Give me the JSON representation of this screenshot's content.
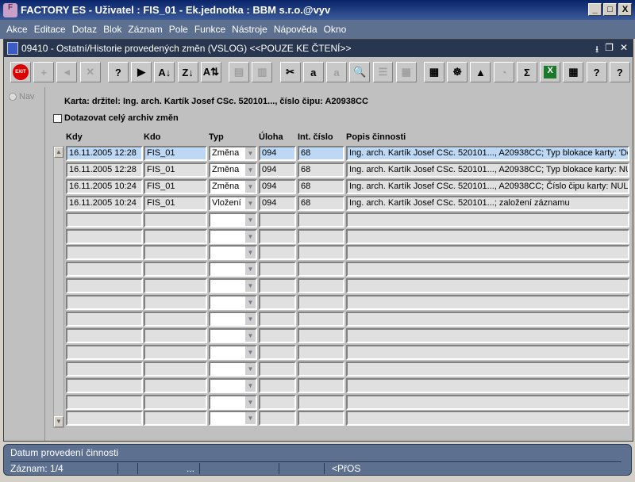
{
  "app": {
    "title": "FACTORY ES - Uživatel : FIS_01 - Ek.jednotka : BBM s.r.o.@vyv",
    "min": "_",
    "max": "□",
    "close": "X"
  },
  "menu": [
    "Akce",
    "Editace",
    "Dotaz",
    "Blok",
    "Záznam",
    "Pole",
    "Funkce",
    "Nástroje",
    "Nápověda",
    "Okno"
  ],
  "form": {
    "title": "09410 - Ostatní/Historie provedených změn (VSLOG) <<POUZE KE ČTENÍ>>"
  },
  "toolbar": [
    {
      "icon": "exit-icon",
      "g": "EXIT"
    },
    {
      "icon": "insert-record-icon",
      "g": "+",
      "dis": true
    },
    {
      "icon": "delete-record-icon",
      "g": "◂",
      "dis": true
    },
    {
      "icon": "clear-icon",
      "g": "✕",
      "dis": true
    },
    {
      "icon": "enter-query-icon",
      "g": "?",
      "gap": true
    },
    {
      "icon": "execute-query-icon",
      "g": "▶"
    },
    {
      "icon": "sort-asc-icon",
      "g": "A↓"
    },
    {
      "icon": "sort-desc-icon",
      "g": "Z↓"
    },
    {
      "icon": "sort-multi-icon",
      "g": "A⇅"
    },
    {
      "icon": "print-icon",
      "g": "▤",
      "dis": true,
      "gap": true
    },
    {
      "icon": "print-setup-icon",
      "g": "▥",
      "dis": true
    },
    {
      "icon": "cut-icon",
      "g": "✂",
      "gap": true
    },
    {
      "icon": "copy-icon",
      "g": "a"
    },
    {
      "icon": "paste-icon",
      "g": "a",
      "dis": true
    },
    {
      "icon": "zoom-icon",
      "g": "🔍"
    },
    {
      "icon": "indent-icon",
      "g": "☰",
      "dis": true
    },
    {
      "icon": "columns-icon",
      "g": "▦",
      "dis": true
    },
    {
      "icon": "calculator-icon",
      "g": "▦",
      "gap": true
    },
    {
      "icon": "wheel-icon",
      "g": "☸"
    },
    {
      "icon": "triangle-icon",
      "g": "▲"
    },
    {
      "icon": "gauge-icon",
      "g": "◔",
      "dis": true
    },
    {
      "icon": "sum-icon",
      "g": "Σ"
    },
    {
      "icon": "excel-icon",
      "g": "X"
    },
    {
      "icon": "report-icon",
      "g": "▦"
    },
    {
      "icon": "help-icon",
      "g": "?"
    },
    {
      "icon": "about-icon",
      "g": "?"
    }
  ],
  "nav": "Nav",
  "caption": "Karta: držitel: Ing. arch. Kartík Josef CSc. 520101...,  číslo čipu: A20938CC",
  "checkbox": "Dotazovat celý archiv změn",
  "columns": [
    "Kdy",
    "Kdo",
    "Typ",
    "Úloha",
    "Int. číslo",
    "Popis činnosti"
  ],
  "rows": [
    [
      "16.11.2005 12:28",
      "FIS_01",
      "Změna",
      "094",
      "68",
      "Ing. arch. Kartík Josef CSc. 520101...,  A20938CC; Typ blokace karty: 'Do"
    ],
    [
      "16.11.2005 12:28",
      "FIS_01",
      "Změna",
      "094",
      "68",
      "Ing. arch. Kartík Josef CSc. 520101...,  A20938CC; Typ blokace karty: NU"
    ],
    [
      "16.11.2005 10:24",
      "FIS_01",
      "Změna",
      "094",
      "68",
      "Ing. arch. Kartík Josef CSc. 520101...,  A20938CC; Číslo čipu karty: NULL"
    ],
    [
      "16.11.2005 10:24",
      "FIS_01",
      "Vložení",
      "094",
      "68",
      "Ing. arch. Kartík Josef CSc. 520101...; založení záznamu"
    ]
  ],
  "empty_rows": 13,
  "status": {
    "hint": "Datum provedení činnosti",
    "record": "Záznam: 1/4",
    "dots": "...",
    "mode": "<PřOS"
  }
}
